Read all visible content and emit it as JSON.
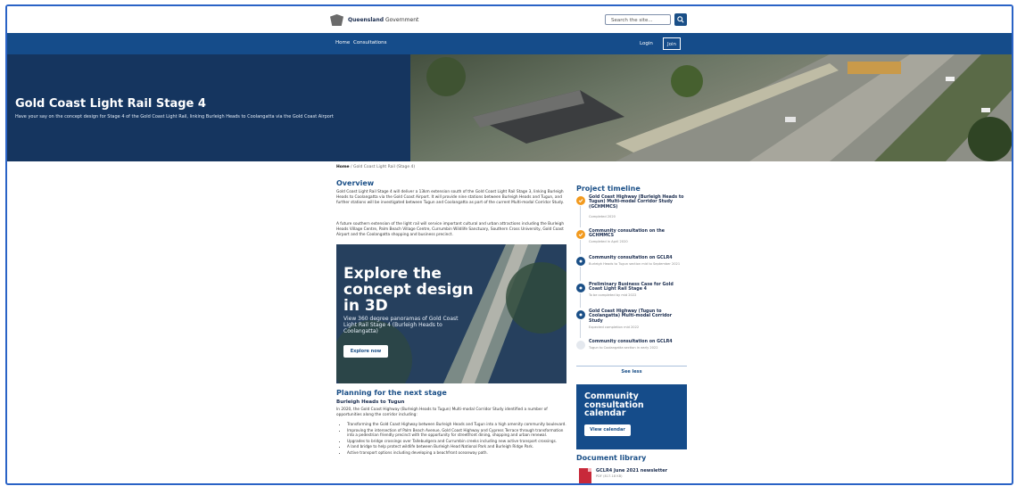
{
  "header": {
    "logo_text_bold": "Queensland",
    "logo_text": "Government",
    "search_placeholder": "Search the site...",
    "icons": {
      "logo": "qld-crest-icon",
      "search": "search-icon"
    }
  },
  "nav": {
    "items": [
      {
        "label": "Home"
      },
      {
        "label": "Consultations"
      }
    ],
    "login_label": "Login",
    "join_label": "Join"
  },
  "hero": {
    "title": "Gold Coast Light Rail Stage 4",
    "subtitle": "Have your say on the concept design for Stage 4 of the Gold Coast Light Rail, linking Burleigh Heads to Coolangatta via the Gold Coast Airport"
  },
  "breadcrumb": {
    "home": "Home",
    "current": "Gold Coast Light Rail (Stage 4)"
  },
  "overview": {
    "title": "Overview",
    "para1": "Gold Coast Light Rail Stage 4 will deliver a 13km extension south of the Gold Coast Light Rail Stage 3, linking Burleigh Heads to Coolangatta via the Gold Coast Airport. It will provide nine stations between Burleigh Heads and Tugun, and further stations will be investigated between Tugun and Coolangatta as part of the current Multi-modal Corridor Study.",
    "para2": "A future southern extension of the light rail will service important cultural and urban attractions including the Burleigh Heads Village Centre, Palm Beach Village Centre, Currumbin Wildlife Sanctuary, Southern Cross University, Gold Coast Airport and the Coolangatta shopping and business precinct."
  },
  "promo": {
    "title": "Explore the concept design in 3D",
    "subtitle": "View 360 degree panoramas of Gold Coast Light Rail Stage 4 (Burleigh Heads to Coolangatta)",
    "button_label": "Explore now"
  },
  "planning": {
    "title": "Planning for the next stage",
    "subtitle": "Burleigh Heads to Tugun",
    "intro": "In 2020, the Gold Coast Highway (Burleigh Heads to Tugun) Multi-modal Corridor Study identified a number of opportunities along the corridor including:",
    "bullets": [
      "Transforming the Gold Coast Highway between Burleigh Heads and Tugun into a high amenity community boulevard.",
      "Improving the intersection of Palm Beach Avenue, Gold Coast Highway and Cypress Terrace through transformation into a pedestrian friendly precinct with the opportunity for streetfront dining, shopping and urban renewal.",
      "Upgrades to bridge crossings over Tallebudgera and Currumbin creeks including new active transport crossings.",
      "A land bridge to help protect wildlife between Burleigh Head National Park and Burleigh Ridge Park.",
      "Active transport options including developing a beachfront oceanway path."
    ]
  },
  "timeline": {
    "title": "Project timeline",
    "items": [
      {
        "name": "Gold Coast Highway (Burleigh Heads to Tugun) Multi-modal Corridor Study (GCHMMCS)",
        "status": "Completed 2020",
        "state": "done"
      },
      {
        "name": "Community consultation on the GCHMMCS",
        "status": "Completed in April 2020",
        "state": "done"
      },
      {
        "name": "Community consultation on GCLR4",
        "status": "Burleigh Heads to Tugun section mid to September 2021",
        "state": "pending"
      },
      {
        "name": "Preliminary Business Case for Gold Coast Light Rail Stage 4",
        "status": "To be completed by mid 2022",
        "state": "pending"
      },
      {
        "name": "Gold Coast Highway (Tugun to Coolangatta) Multi-modal Corridor Study",
        "status": "Expected completion mid 2022",
        "state": "pending"
      },
      {
        "name": "Community consultation on GCLR4",
        "status": "Tugun to Coolangatta section in early 2022",
        "state": "future"
      }
    ],
    "see_less_label": "See less"
  },
  "calendar": {
    "title": "Community consultation calendar",
    "button_label": "View calendar"
  },
  "documents": {
    "title": "Document library",
    "items": [
      {
        "name": "GCLR4 June 2021 newsletter",
        "meta": "PDF (817.18 KB)",
        "icon": "pdf-icon"
      }
    ]
  }
}
